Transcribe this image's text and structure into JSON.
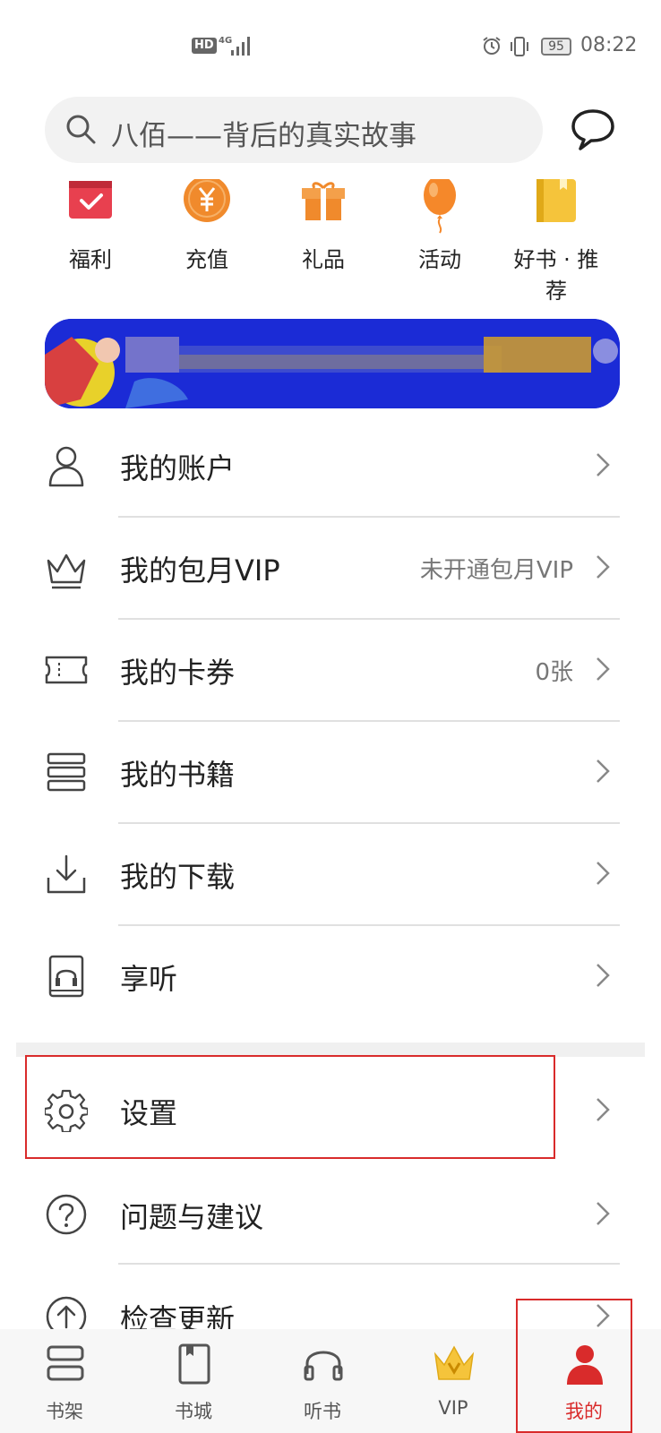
{
  "status_bar": {
    "hd": "HD",
    "network": "4G",
    "battery": "95",
    "time": "08:22"
  },
  "search": {
    "placeholder": "八佰——背后的真实故事"
  },
  "quick_links": [
    {
      "label": "福利",
      "icon": "gift-calendar-icon"
    },
    {
      "label": "充值",
      "icon": "yen-coin-icon"
    },
    {
      "label": "礼品",
      "icon": "gift-box-icon"
    },
    {
      "label": "活动",
      "icon": "balloon-icon"
    },
    {
      "label": "好书 · 推荐",
      "icon": "book-icon"
    }
  ],
  "menu": [
    {
      "label": "我的账户",
      "value": "",
      "icon": "user-icon"
    },
    {
      "label": "我的包月VIP",
      "value": "未开通包月VIP",
      "icon": "crown-icon"
    },
    {
      "label": "我的卡券",
      "value": "0张",
      "icon": "ticket-icon"
    },
    {
      "label": "我的书籍",
      "value": "",
      "icon": "books-icon"
    },
    {
      "label": "我的下载",
      "value": "",
      "icon": "download-icon"
    },
    {
      "label": "享听",
      "value": "",
      "icon": "headphone-book-icon"
    }
  ],
  "menu2": [
    {
      "label": "设置",
      "icon": "gear-icon"
    },
    {
      "label": "问题与建议",
      "icon": "question-icon"
    },
    {
      "label": "检查更新",
      "icon": "upload-icon"
    }
  ],
  "bottom_nav": [
    {
      "label": "书架",
      "icon": "bookshelf-icon"
    },
    {
      "label": "书城",
      "icon": "bookstore-icon"
    },
    {
      "label": "听书",
      "icon": "headphones-icon"
    },
    {
      "label": "VIP",
      "icon": "vip-crown-icon"
    },
    {
      "label": "我的",
      "icon": "profile-icon"
    }
  ],
  "colors": {
    "accent_red": "#d92b2b",
    "banner_blue": "#1b2bd6",
    "orange": "#f08a2c",
    "gold": "#f5c43b"
  }
}
